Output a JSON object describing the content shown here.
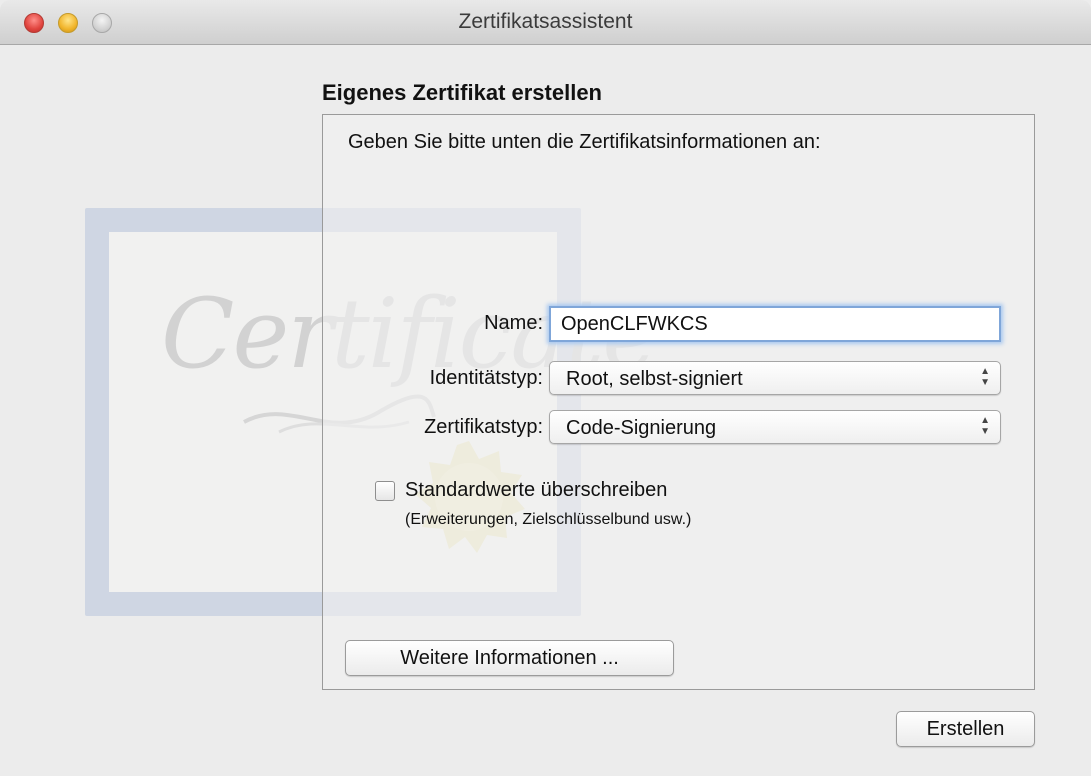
{
  "window": {
    "title": "Zertifikatsassistent"
  },
  "art": {
    "certificate_word": "Certificate"
  },
  "form": {
    "heading": "Eigenes Zertifikat erstellen",
    "instruction": "Geben Sie bitte unten die Zertifikatsinformationen an:",
    "name_label": "Name:",
    "name_value": "OpenCLFWKCS",
    "identity_label": "Identitätstyp:",
    "identity_value": "Root, selbst-signiert",
    "cert_type_label": "Zertifikatstyp:",
    "cert_type_value": "Code-Signierung",
    "override_label": "Standardwerte überschreiben",
    "override_checked": false,
    "override_hint": "(Erweiterungen, Zielschlüsselbund usw.)",
    "more_info_label": "Weitere Informationen ..."
  },
  "footer": {
    "create_label": "Erstellen"
  },
  "icons": {
    "close": "close-icon",
    "minimize": "minimize-icon",
    "zoom": "zoom-icon",
    "popup_arrows": "updown-arrows-icon"
  },
  "colors": {
    "focus_ring": "#7fa6d9",
    "close": "#e0443e",
    "minimize": "#f1b42a"
  }
}
